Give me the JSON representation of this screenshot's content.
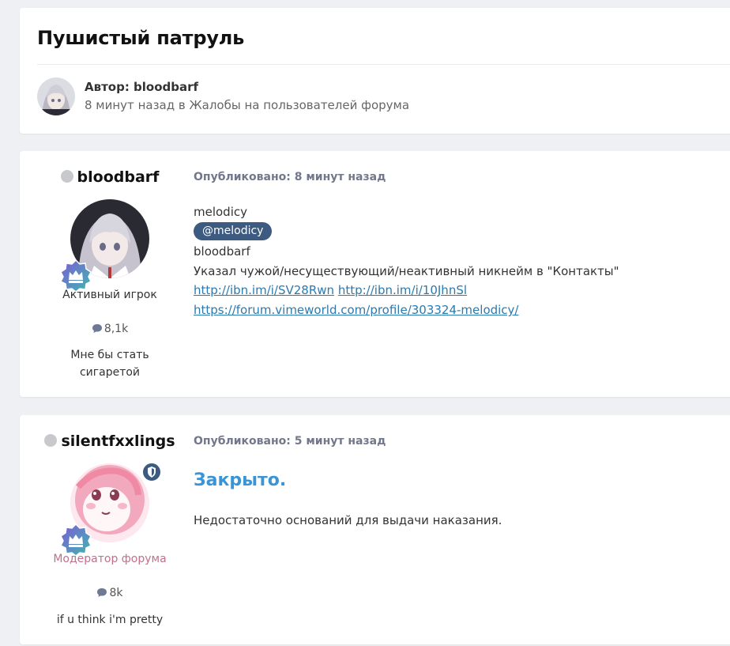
{
  "topic": {
    "title": "Пушистый патруль",
    "author_line": "Автор: bloodbarf",
    "meta_line": "8 минут назад в Жалобы на пользователей форума"
  },
  "posts": [
    {
      "username": "bloodbarf",
      "rank": "Активный игрок",
      "post_count": "8,1k",
      "signature": "Мне бы стать сигаретой",
      "posted": "Опубликовано: 8 минут назад",
      "lines": {
        "l1": "melodicy",
        "mention": "@melodicy",
        "l2": "bloodbarf",
        "l3": "Указал чужой/несуществующий/неактивный никнейм в \"Контакты\"",
        "link1": "http://ibn.im/i/SV28Rwn",
        "link2": "http://ibn.im/i/10JhnSl",
        "link3": "https://forum.vimeworld.com/profile/303324-melodicy/"
      }
    },
    {
      "username": "silentfxxlings",
      "rank": "Модератор форума",
      "post_count": "8k",
      "signature": "if u think i'm pretty",
      "posted": "Опубликовано: 5 минут назад",
      "heading": "Закрыто.",
      "body": "Недостаточно оснований для выдачи наказания."
    }
  ],
  "colors": {
    "mention_bg": "#3d5a80",
    "link": "#2a7ab0",
    "closed_heading": "#3a95d6",
    "moderator_rank": "#c0708e"
  },
  "icons": {
    "online_status": "status-dot",
    "posts": "comment-icon",
    "rank": "crown-badge-icon",
    "moderator": "shield-icon"
  }
}
